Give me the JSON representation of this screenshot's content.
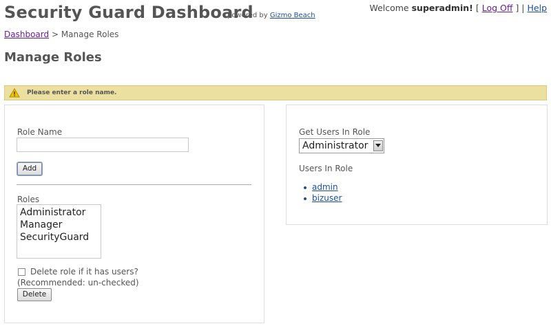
{
  "header": {
    "title": "Security Guard Dashboard",
    "powered_prefix": "powered by",
    "powered_link": "Gizmo Beach",
    "welcome_prefix": "Welcome",
    "username": "superadmin!",
    "logoff_label": "Log Off",
    "help_label": "Help"
  },
  "breadcrumb": {
    "root": "Dashboard",
    "separator": ">",
    "current": "Manage Roles"
  },
  "page_title": "Manage Roles",
  "warning": {
    "message": "Please enter a role name.",
    "icon": "warning-icon",
    "background": "#ebe0a0"
  },
  "left_panel": {
    "role_name_label": "Role Name",
    "role_name_value": "",
    "add_button": "Add",
    "roles_label": "Roles",
    "roles": [
      "Administrator",
      "Manager",
      "SecurityGuard"
    ],
    "delete_checkbox_label": "Delete role if it has users?",
    "delete_checkbox_checked": false,
    "recommendation": "(Recommended: un-checked)",
    "delete_button": "Delete"
  },
  "right_panel": {
    "get_users_label": "Get Users In Role",
    "selected_role": "Administrator",
    "users_in_role_label": "Users In Role",
    "users": [
      "admin",
      "bizuser"
    ]
  }
}
